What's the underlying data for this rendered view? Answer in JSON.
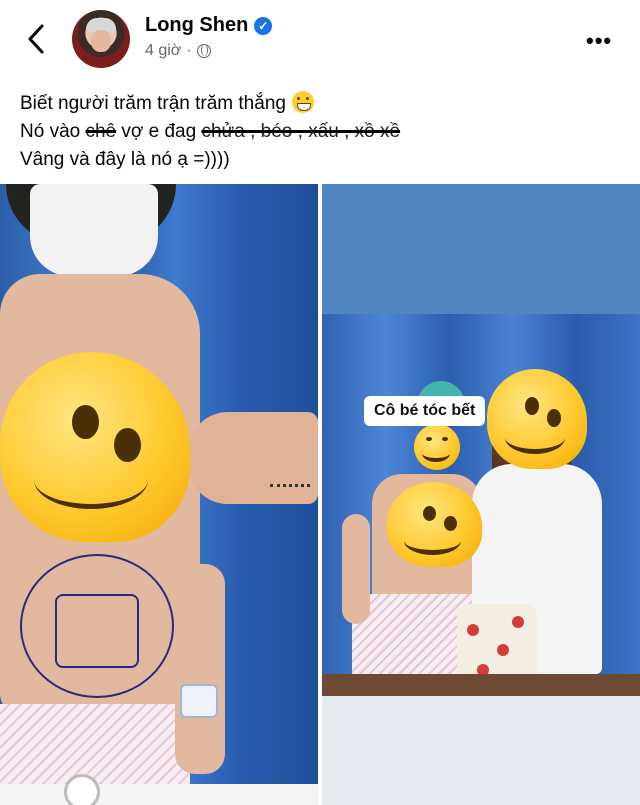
{
  "header": {
    "author": "Long Shen",
    "time": "4 giờ",
    "separator": "·",
    "verified_mark": "✓",
    "more_label": "•••",
    "back_icon": "chevron-left-icon",
    "privacy_icon": "globe-icon"
  },
  "post": {
    "line1": "Biết người trăm trận trăm thắng",
    "line2_prefix": "Nó vào ",
    "line2_strike1": "chê",
    "line2_middle": " vợ e đag ",
    "line2_strike2": "chửa , béo , xấu , xồ xề",
    "line3": "Vâng và đây là nó ạ =))))"
  },
  "photo_right": {
    "label": "Cô bé tóc bết"
  },
  "colors": {
    "accent": "#1b74e4",
    "text": "#050505",
    "muted": "#65676b"
  }
}
